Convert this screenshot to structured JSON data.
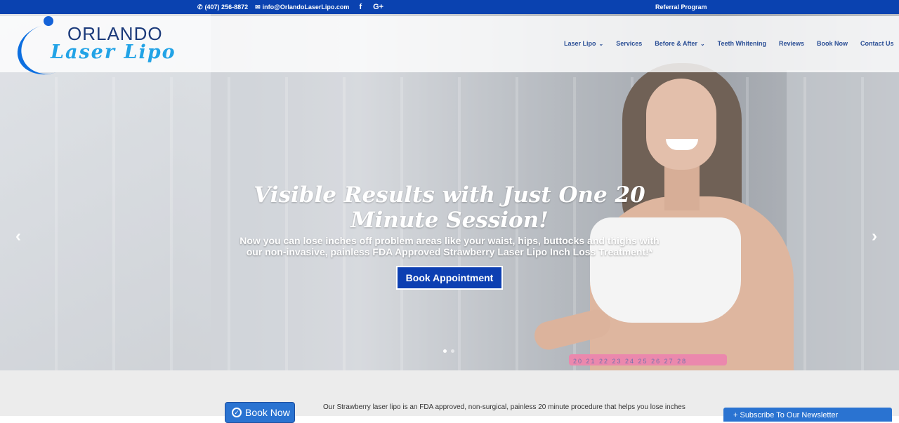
{
  "topbar": {
    "phone": "(407) 256-8872",
    "email": "info@OrlandoLaserLipo.com",
    "social_facebook": "f",
    "social_googleplus": "G+",
    "referral": "Referral Program"
  },
  "logo": {
    "line1": "ORLANDO",
    "line2": "Laser Lipo"
  },
  "nav": {
    "items": [
      {
        "label": "Laser Lipo",
        "has_dropdown": true
      },
      {
        "label": "Services",
        "has_dropdown": false
      },
      {
        "label": "Before & After",
        "has_dropdown": true
      },
      {
        "label": "Teeth Whitening",
        "has_dropdown": false
      },
      {
        "label": "Reviews",
        "has_dropdown": false
      },
      {
        "label": "Book Now",
        "has_dropdown": false
      },
      {
        "label": "Contact Us",
        "has_dropdown": false
      }
    ],
    "caret": "⌄"
  },
  "hero": {
    "title": "Visible Results with Just One 20 Minute Session!",
    "subtitle": "Now you can lose inches off problem areas like your waist, hips, buttocks and thighs with our non-invasive, painless FDA Approved Strawberry Laser Lipo Inch Loss Treatment!*",
    "cta": "Book Appointment",
    "prev_arrow": "‹",
    "next_arrow": "›",
    "tape_numbers": "20 21 22 23 24 25 26 27 28",
    "slides": 2,
    "active_slide": 1
  },
  "lower": {
    "book_now": "Book Now",
    "body_text": "Our Strawberry laser lipo is an FDA approved, non-surgical, painless 20 minute procedure that helps you lose inches",
    "newsletter": "+ Subscribe To Our Newsletter"
  },
  "colors": {
    "brand_blue": "#0a42b0",
    "button_blue": "#0d3fb2",
    "nav_text": "#2a4e95",
    "logo_light_blue": "#22a3e6"
  }
}
